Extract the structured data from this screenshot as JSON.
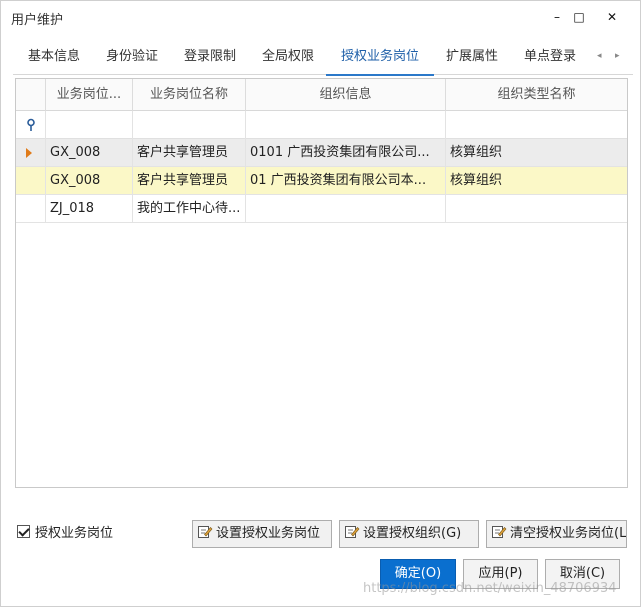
{
  "window": {
    "title": "用户维护",
    "controls": {
      "minimize": "–",
      "maximize": "□",
      "close": "✕"
    }
  },
  "tabs": [
    {
      "label": "基本信息",
      "active": false
    },
    {
      "label": "身份验证",
      "active": false
    },
    {
      "label": "登录限制",
      "active": false
    },
    {
      "label": "全局权限",
      "active": false
    },
    {
      "label": "授权业务岗位",
      "active": true
    },
    {
      "label": "扩展属性",
      "active": false
    },
    {
      "label": "单点登录",
      "active": false
    }
  ],
  "tab_scroll": {
    "left": "◂",
    "right": "▸"
  },
  "grid": {
    "columns": [
      "业务岗位...",
      "业务岗位名称",
      "组织信息",
      "组织类型名称"
    ],
    "rows": [
      {
        "code": "GX_008",
        "name": "客户共享管理员",
        "org": "0101 广西投资集团有限公司...",
        "org_type": "核算组织",
        "current": true
      },
      {
        "code": "GX_008",
        "name": "客户共享管理员",
        "org": "01 广西投资集团有限公司本...",
        "org_type": "核算组织",
        "current": false
      },
      {
        "code": "ZJ_018",
        "name": "我的工作中心待...",
        "org": "",
        "org_type": "",
        "current": false
      }
    ]
  },
  "footer": {
    "checkbox_label": "授权业务岗位",
    "checkbox_checked": true,
    "buttons": {
      "set_post": "设置授权业务岗位",
      "set_org": "设置授权组织(G)",
      "clear_post": "清空授权业务岗位(L"
    },
    "ok": "确定(O)",
    "apply": "应用(P)",
    "cancel": "取消(C)"
  },
  "watermark": "https://blog.csdn.net/weixin_48706934",
  "colors": {
    "accent": "#2b78c9",
    "primary_button": "#0a6fcf",
    "selected_row": "#ececec",
    "highlight_row": "#fbf8c7",
    "row_indicator": "#e07b19"
  }
}
